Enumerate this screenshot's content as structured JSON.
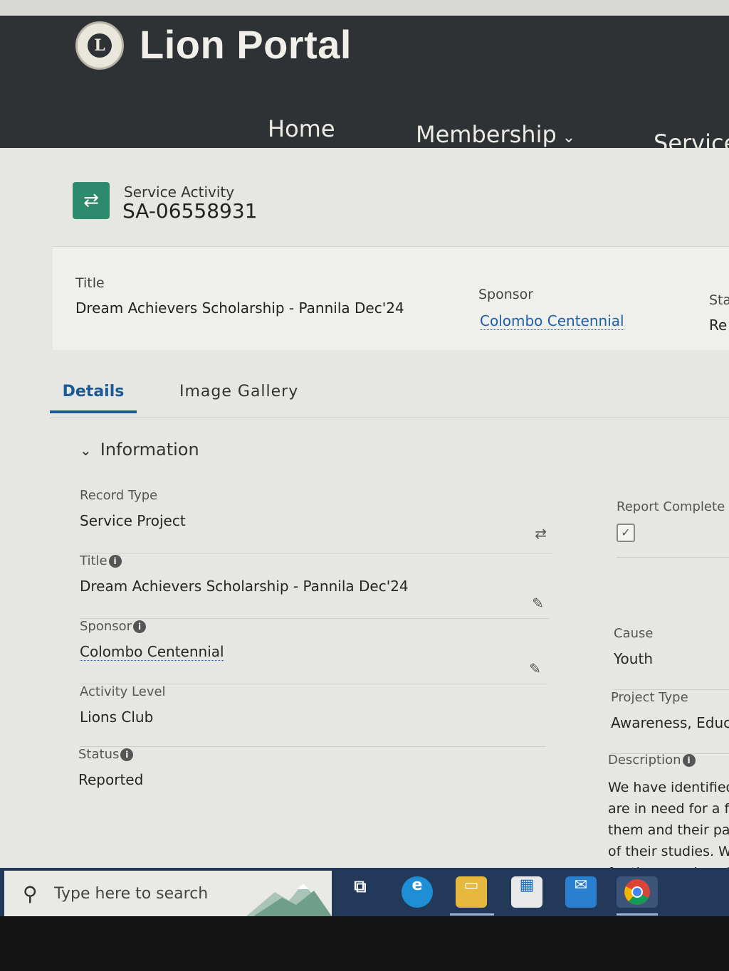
{
  "header": {
    "app_title": "Lion Portal",
    "logo_letter": "L",
    "nav": {
      "home": "Home",
      "membership": "Membership",
      "service": "Service"
    }
  },
  "record": {
    "object_label": "Service Activity",
    "record_id": "SA-06558931"
  },
  "highlights": {
    "title_label": "Title",
    "title_value": "Dream Achievers Scholarship - Pannila Dec'24",
    "sponsor_label": "Sponsor",
    "sponsor_value": "Colombo Centennial",
    "status_label": "Sta",
    "status_value": "Re"
  },
  "tabs": {
    "details": "Details",
    "gallery": "Image Gallery"
  },
  "section": {
    "title": "Information"
  },
  "fields_left": {
    "record_type_label": "Record Type",
    "record_type_value": "Service Project",
    "title_label": "Title",
    "title_value": "Dream Achievers Scholarship - Pannila Dec'24",
    "sponsor_label": "Sponsor",
    "sponsor_value": "Colombo Centennial",
    "activity_level_label": "Activity Level",
    "activity_level_value": "Lions Club",
    "status_label": "Status",
    "status_value": "Reported"
  },
  "fields_right": {
    "report_complete_label": "Report Complete",
    "report_complete_checked": true,
    "cause_label": "Cause",
    "cause_value": "Youth",
    "project_type_label": "Project Type",
    "project_type_value": "Awareness, Educa",
    "description_label": "Description",
    "description_lines": [
      "We have identified",
      "are in need for a fi",
      "them and their pa",
      "of their studies. W",
      "for them such as P"
    ]
  },
  "taskbar": {
    "search_placeholder": "Type here to search"
  },
  "colors": {
    "header_bg": "#2e3235",
    "accent_tab": "#1b5a96",
    "link": "#1f5fa7",
    "record_icon": "#2e8a6c",
    "taskbar_bg": "#22395a"
  }
}
